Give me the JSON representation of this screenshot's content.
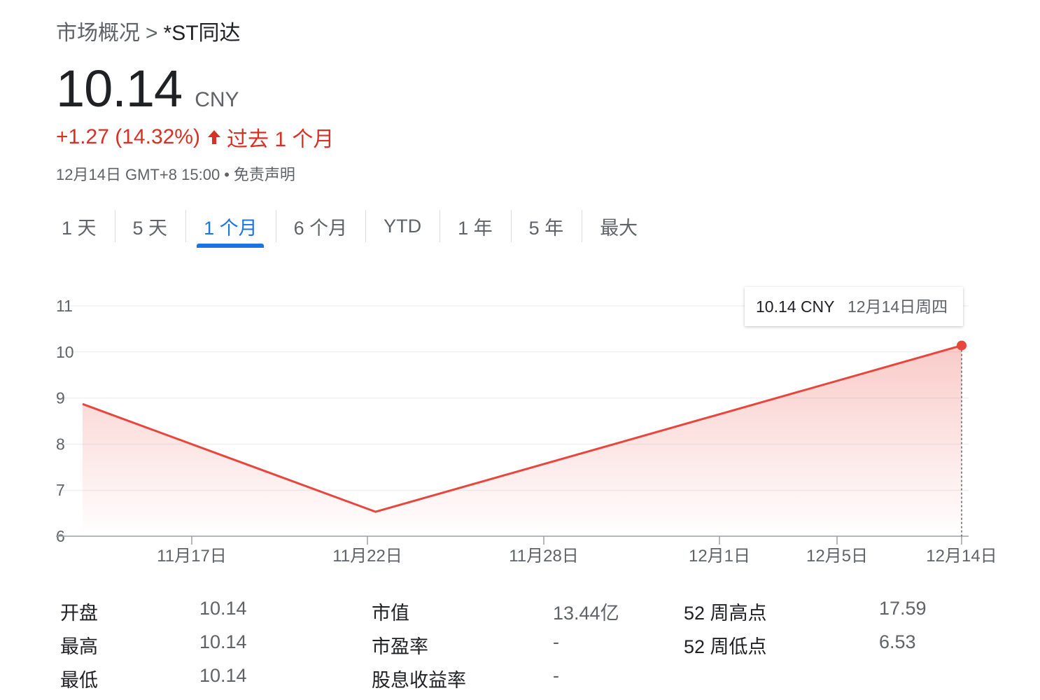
{
  "breadcrumb": {
    "parent": "市场概况",
    "separator": ">",
    "current": "*ST同达"
  },
  "quote": {
    "price": "10.14",
    "currency": "CNY",
    "change": "+1.27 (14.32%)",
    "period": "过去 1 个月",
    "timestamp": "12月14日 GMT+8 15:00",
    "bullet": "•",
    "disclaimer": "免责声明"
  },
  "tabs": [
    {
      "label": "1 天"
    },
    {
      "label": "5 天"
    },
    {
      "label": "1 个月",
      "active": true
    },
    {
      "label": "6 个月"
    },
    {
      "label": "YTD"
    },
    {
      "label": "1 年"
    },
    {
      "label": "5 年"
    },
    {
      "label": "最大"
    }
  ],
  "tooltip": {
    "price": "10.14 CNY",
    "date": "12月14日周四"
  },
  "colors": {
    "accent": "#1a73e8",
    "down_red": "#d93025",
    "line": "#e8453c",
    "text_muted": "#5f6368"
  },
  "stats": {
    "open_label": "开盘",
    "open": "10.14",
    "high_label": "最高",
    "high": "10.14",
    "low_label": "最低",
    "low": "10.14",
    "mktcap_label": "市值",
    "mktcap": "13.44亿",
    "pe_label": "市盈率",
    "pe": "-",
    "div_label": "股息收益率",
    "div": "-",
    "high52_label": "52 周高点",
    "high52": "17.59",
    "low52_label": "52 周低点",
    "low52": "6.53"
  },
  "chart_data": {
    "type": "area",
    "x_ticks": [
      "11月17日",
      "11月22日",
      "11月28日",
      "12月1日",
      "12月5日",
      "12月14日"
    ],
    "y_ticks": [
      6,
      7,
      8,
      9,
      10,
      11
    ],
    "ylim": [
      6,
      11
    ],
    "points": [
      {
        "x": "11月14日",
        "y": 8.87
      },
      {
        "x": "11月24日",
        "y": 6.53
      },
      {
        "x": "12月14日",
        "y": 10.14
      }
    ],
    "grid": true,
    "series_color": "#e8453c"
  }
}
